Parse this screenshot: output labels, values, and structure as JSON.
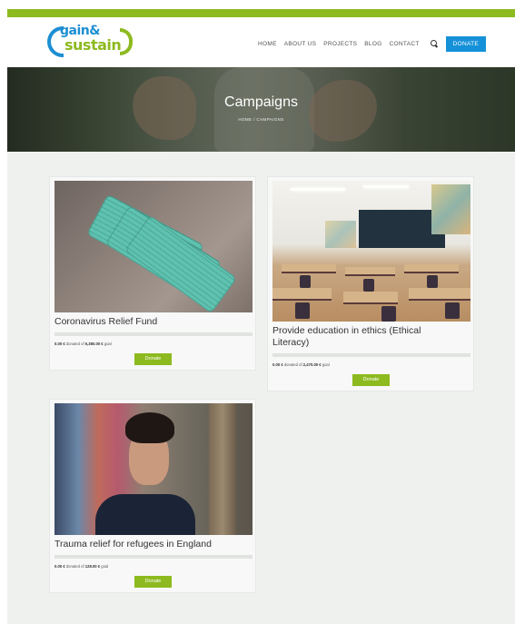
{
  "brand": {
    "logo_line1": "gain&",
    "logo_line2": "sustain",
    "accent_green": "#8dba1f",
    "accent_blue": "#1591d9"
  },
  "nav": {
    "items": [
      "HOME",
      "ABOUT US",
      "PROJECTS",
      "BLOG",
      "CONTACT"
    ],
    "search_icon": "search-icon",
    "donate_label": "DONATE"
  },
  "hero": {
    "title": "Campaigns",
    "breadcrumb": "HOME / CAMPAIGNS"
  },
  "campaigns": [
    {
      "title": "Coronavirus Relief Fund",
      "donated": "0.00 €",
      "donated_text": "donated of",
      "goal": "5,380.00 €",
      "goal_text": "goal",
      "progress": 0,
      "button": "Donate"
    },
    {
      "title": "Provide education in ethics (Ethical Literacy)",
      "donated": "0.00 €",
      "donated_text": "donated of",
      "goal": "2,470.00 €",
      "goal_text": "goal",
      "progress": 0,
      "button": "Donate"
    },
    {
      "title": "Trauma relief for refugees in England",
      "donated": "0.00 €",
      "donated_text": "donated of",
      "goal": "128.00 €",
      "goal_text": "goal",
      "progress": 0,
      "button": "Donate"
    }
  ]
}
